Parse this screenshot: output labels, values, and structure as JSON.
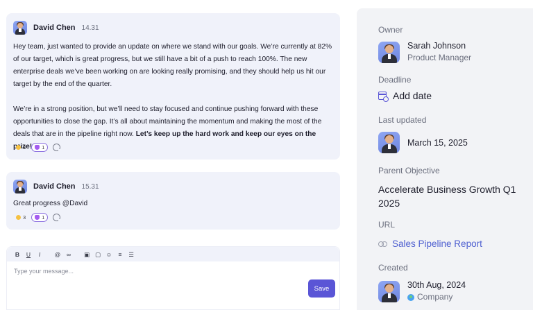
{
  "messages": [
    {
      "author": "David Chen",
      "time": "14.31",
      "paragraph1": "Hey team, just wanted to provide an update on where we stand with our goals. We’re currently at 82% of our target, which is great progress, but we still have a bit of a push to reach 100%. The new enterprise deals we’ve been working on are looking really promising, and they should help us hit our target by the end of the quarter.",
      "paragraph2": "We’re in a strong position, but we’ll need to stay focused and continue pushing forward with these opportunities to close the gap. It’s all about maintaining the momentum and making the most of the deals that are in the pipeline right now. ",
      "paragraph2_bold": "Let’s keep up the hard work and keep our eyes on the prize!",
      "reactions": [
        {
          "icon": "smile-emoji-icon",
          "count": "3"
        },
        {
          "icon": "purple-heart-emoji-icon",
          "count": "1"
        }
      ]
    },
    {
      "author": "David Chen",
      "time": "15.31",
      "text": "Great progress @David",
      "reactions": [
        {
          "icon": "smile-emoji-icon",
          "count": "3"
        },
        {
          "icon": "purple-heart-emoji-icon",
          "count": "1"
        }
      ]
    }
  ],
  "composer": {
    "toolbar": [
      "B",
      "U",
      "I",
      "@",
      "link",
      "image",
      "gif",
      "emoji",
      "numbered-list",
      "bullet-list"
    ],
    "placeholder": "Type your message...",
    "save_label": "Save"
  },
  "details": {
    "owner_label": "Owner",
    "owner_name": "Sarah Johnson",
    "owner_role": "Product Manager",
    "deadline_label": "Deadline",
    "deadline_value": "Add date",
    "last_updated_label": "Last updated",
    "last_updated_value": "March 15, 2025",
    "parent_objective_label": "Parent Objective",
    "parent_objective_value": "Accelerate Business Growth Q1 2025",
    "url_label": "URL",
    "url_value": "Sales Pipeline Report",
    "created_label": "Created",
    "created_date": "30th Aug, 2024",
    "created_org": "Company"
  },
  "colors": {
    "accent": "#5a55d6",
    "link": "#4e5fd0",
    "card_bg": "#f0f2fa",
    "panel_bg": "#f2f3f6"
  }
}
